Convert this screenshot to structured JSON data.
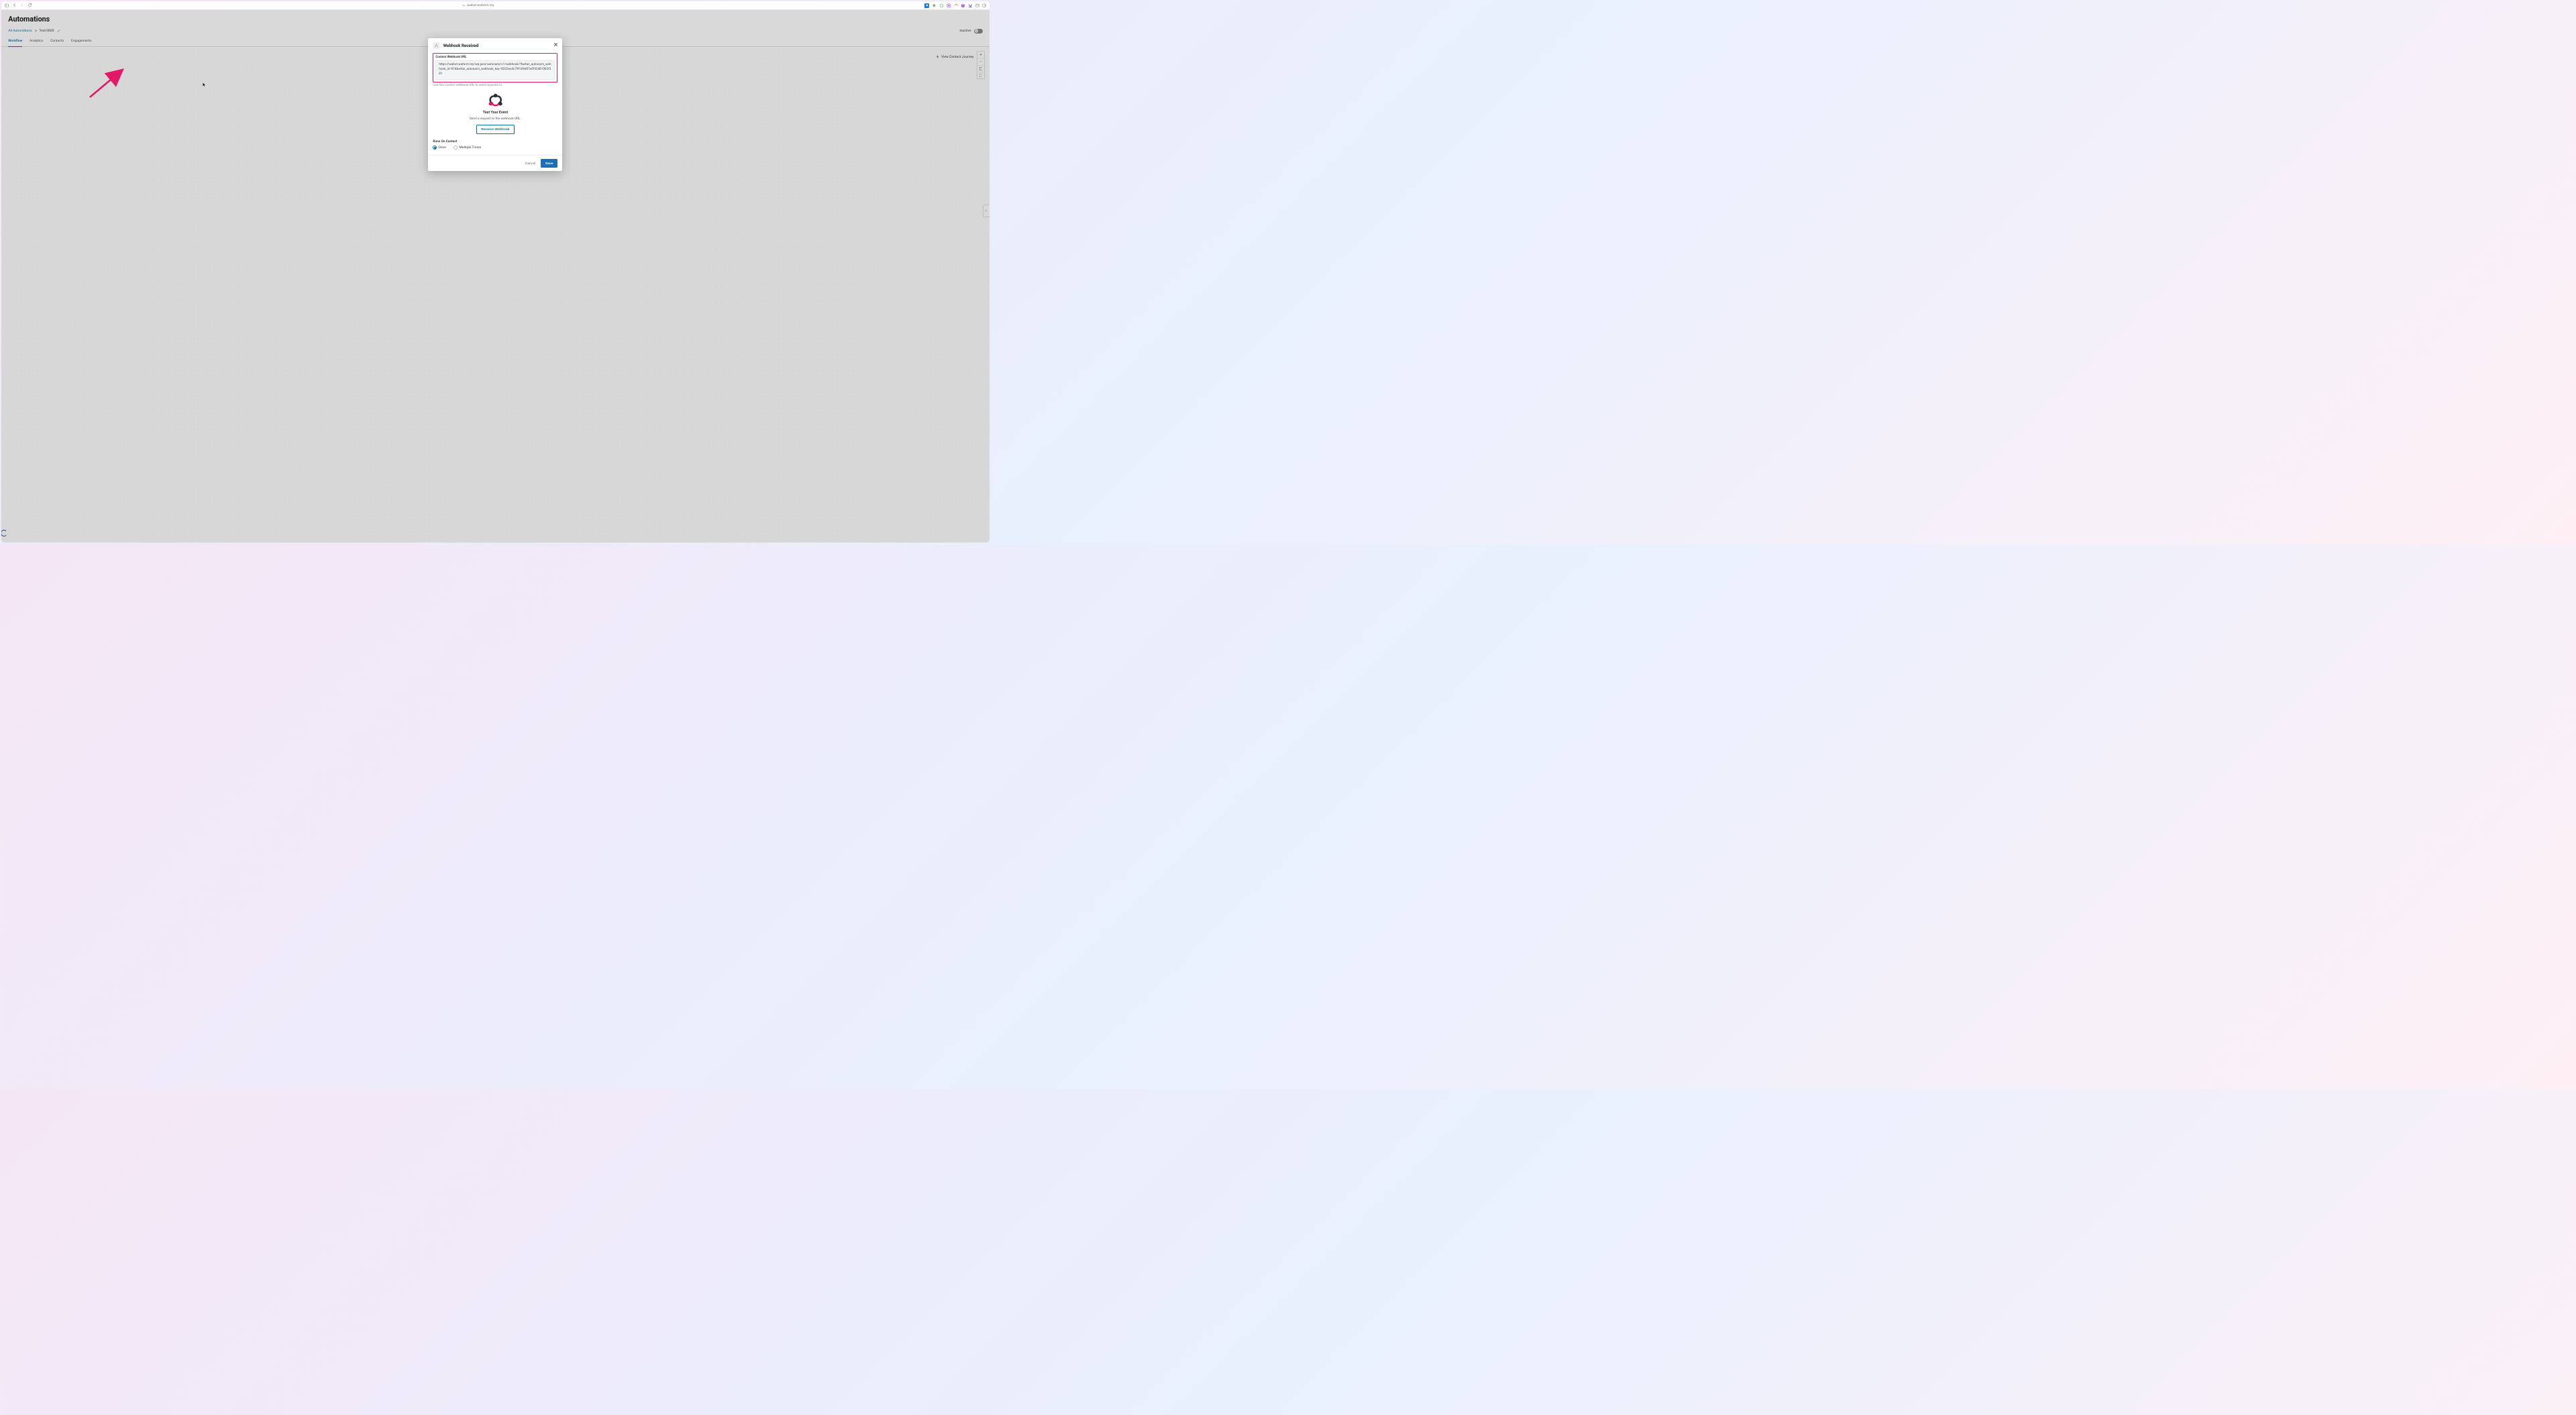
{
  "browser": {
    "url_host": "wabot.waform.my"
  },
  "page": {
    "title": "Automations",
    "breadcrumb": {
      "root": "All Automations",
      "current": "Test 0605"
    },
    "status_label": "Inactive",
    "tabs": [
      "Workflow",
      "Analytics",
      "Contacts",
      "Engagements"
    ],
    "active_tab_index": 0,
    "view_contact_journey": "View Contact Journey"
  },
  "modal": {
    "title": "Webhook Received",
    "url_label": "Custom Webhook URL",
    "url_value": "https://wabot.waform.my/wp-json/autonami/v1/webhook/?bwfan_autonami_webhook_id=61&bwfan_autonami_webhook_key=8222ecdc79f169d07af292481562f381",
    "url_hint": "Use this custom webhook URL to send requests to.",
    "test_title": "Test Your Event",
    "test_sub": "Send a request to the webhook URL.",
    "receive_btn": "Receive Webhook",
    "runs_label": "Runs On Contact",
    "radio_once": "Once",
    "radio_multiple": "Multiple Times",
    "runs_selected": "once",
    "cancel": "Cancel",
    "save": "Save"
  }
}
